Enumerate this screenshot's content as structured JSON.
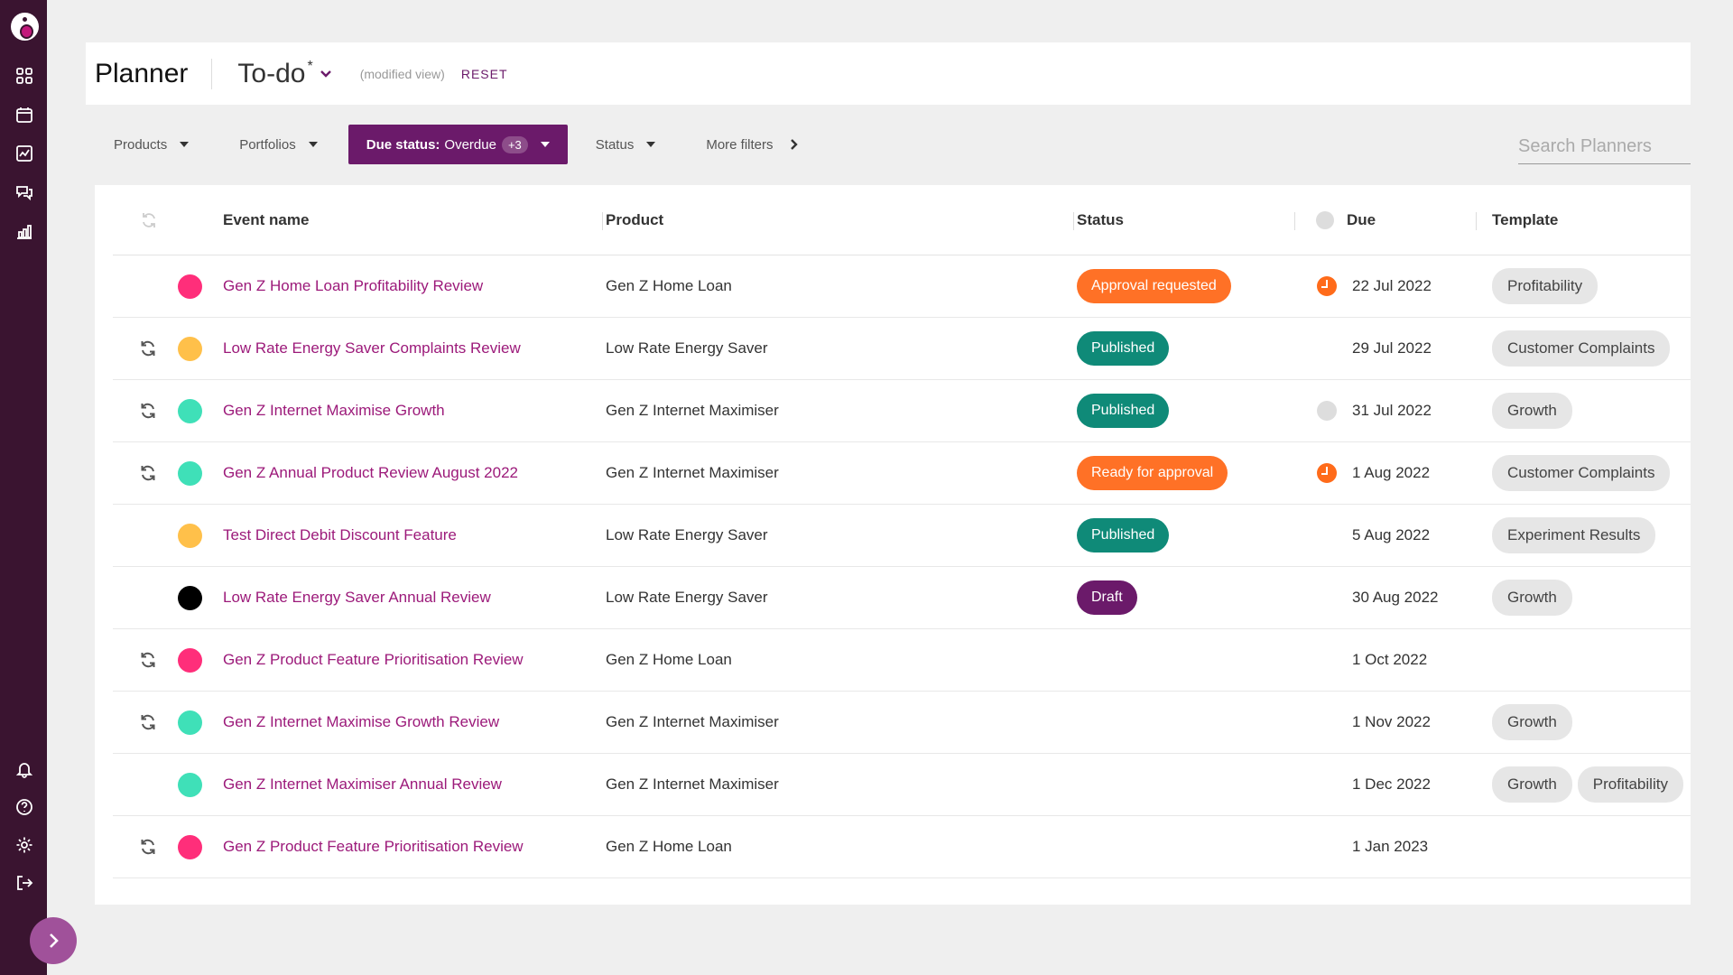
{
  "header": {
    "title": "Planner",
    "view_name": "To-do",
    "view_modified_mark": "*",
    "modified_label": "(modified view)",
    "reset_label": "RESET"
  },
  "filters": {
    "products": "Products",
    "portfolios": "Portfolios",
    "due_status_label": "Due status:",
    "due_status_value": "Overdue",
    "due_status_count": "+3",
    "status": "Status",
    "more": "More filters"
  },
  "search": {
    "placeholder": "Search Planners"
  },
  "table": {
    "columns": {
      "event": "Event name",
      "product": "Product",
      "status": "Status",
      "due": "Due",
      "template": "Template"
    },
    "rows": [
      {
        "sync": false,
        "dot_color": "#ff2e7a",
        "event": "Gen Z Home Loan Profitability Review",
        "product": "Gen Z Home Loan",
        "status": "Approval requested",
        "status_color": "#ff7126",
        "due_icon": "overdue-clock",
        "due": "22 Jul 2022",
        "templates": [
          "Profitability"
        ]
      },
      {
        "sync": true,
        "dot_color": "#ffc04a",
        "event": "Low Rate Energy Saver Complaints Review",
        "product": "Low Rate Energy Saver",
        "status": "Published",
        "status_color": "#0f8a78",
        "due_icon": "none",
        "due": "29 Jul 2022",
        "templates": [
          "Customer Complaints"
        ]
      },
      {
        "sync": true,
        "dot_color": "#3fe0b8",
        "event": "Gen Z Internet Maximise Growth",
        "product": "Gen Z Internet Maximiser",
        "status": "Published",
        "status_color": "#0f8a78",
        "due_icon": "grey-clock",
        "due": "31 Jul 2022",
        "templates": [
          "Growth"
        ]
      },
      {
        "sync": true,
        "dot_color": "#3fe0b8",
        "event": "Gen Z Annual Product Review August 2022",
        "product": "Gen Z Internet Maximiser",
        "status": "Ready for approval",
        "status_color": "#ff7126",
        "due_icon": "overdue-clock",
        "due": "1 Aug 2022",
        "templates": [
          "Customer Complaints"
        ]
      },
      {
        "sync": false,
        "dot_color": "#ffc04a",
        "event": "Test Direct Debit Discount Feature",
        "product": "Low Rate Energy Saver",
        "status": "Published",
        "status_color": "#0f8a78",
        "due_icon": "none",
        "due": "5 Aug 2022",
        "templates": [
          "Experiment Results"
        ]
      },
      {
        "sync": false,
        "dot_color": "#000000",
        "event": "Low Rate Energy Saver Annual Review",
        "product": "Low Rate Energy Saver",
        "status": "Draft",
        "status_color": "#6b1a6a",
        "due_icon": "none",
        "due": "30 Aug 2022",
        "templates": [
          "Growth"
        ]
      },
      {
        "sync": true,
        "dot_color": "#ff2e7a",
        "event": "Gen Z Product Feature Prioritisation Review",
        "product": "Gen Z Home Loan",
        "status": "",
        "status_color": "",
        "due_icon": "none",
        "due": "1 Oct 2022",
        "templates": []
      },
      {
        "sync": true,
        "dot_color": "#3fe0b8",
        "event": "Gen Z Internet Maximise Growth Review",
        "product": "Gen Z Internet Maximiser",
        "status": "",
        "status_color": "",
        "due_icon": "none",
        "due": "1 Nov 2022",
        "templates": [
          "Growth"
        ]
      },
      {
        "sync": false,
        "dot_color": "#3fe0b8",
        "event": "Gen Z Internet Maximiser Annual Review",
        "product": "Gen Z Internet Maximiser",
        "status": "",
        "status_color": "",
        "due_icon": "none",
        "due": "1 Dec 2022",
        "templates": [
          "Growth",
          "Profitability"
        ]
      },
      {
        "sync": true,
        "dot_color": "#ff2e7a",
        "event": "Gen Z Product Feature Prioritisation Review",
        "product": "Gen Z Home Loan",
        "status": "",
        "status_color": "",
        "due_icon": "none",
        "due": "1 Jan 2023",
        "templates": []
      }
    ]
  }
}
